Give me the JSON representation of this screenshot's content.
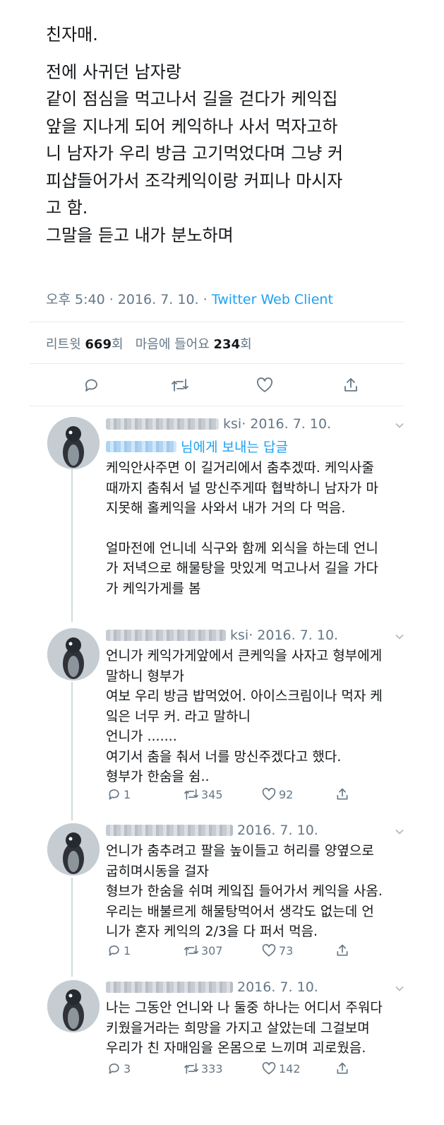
{
  "tweet": {
    "lines": [
      "친자매.",
      "",
      "전에 사귀던 남자랑",
      "같이 점심을 먹고나서 길을 걷다가  케익집",
      "앞을 지나게 되어 케익하나 사서 먹자고하",
      "니 남자가 우리 방금 고기먹었다며 그냥 커",
      "피샵들어가서 조각케익이랑 커피나 마시자",
      "고 함.",
      "그말을 듣고 내가 분노하며"
    ],
    "time": "오후 5:40 · 2016. 7. 10. · ",
    "client": "Twitter Web Client",
    "retweets_label": "리트윗 ",
    "retweets": "669",
    "retweets_unit": "회",
    "likes_label": "마음에 들어요 ",
    "likes": "234",
    "likes_unit": "회"
  },
  "icons": {
    "reply": "reply-icon",
    "retweet": "retweet-icon",
    "like": "heart-icon",
    "share": "share-icon",
    "more": "chevron-down-icon"
  },
  "colors": {
    "link": "#1da1f2",
    "muted": "#657786",
    "text": "#14171a"
  },
  "replies": [
    {
      "name_visible": "",
      "handle_visible": "ksi",
      "date": "· 2016. 7. 10.",
      "reply_to_suffix": "님에게 보내는 답글",
      "lines": [
        "케익안사주면 이 길거리에서 춤추겠따. 케익사줄",
        "때까지 춤춰서 널 망신주게따 협박하니 남자가 마",
        "지못해 홀케익을 사와서 내가 거의 다 먹음.",
        "",
        "얼마전에 언니네 식구와 함께 외식을 하는데 언니",
        "가 저녁으로 해물탕을 맛있게 먹고나서 길을 가다",
        "가 케익가게를 봄"
      ],
      "stats": null
    },
    {
      "name_visible": "",
      "handle_visible": "ksi",
      "date": "· 2016. 7. 10.",
      "reply_to_suffix": "",
      "lines": [
        "언니가 케익가게앞에서 큰케익을 사자고 형부에게",
        "말하니 형부가",
        "여보 우리 방금 밥먹었어. 아이스크림이나 먹자 케",
        "잌은 너무 커. 라고 말하니",
        "언니가 .......",
        "여기서 춤을 춰서 너를 망신주겠다고 했다.",
        "형부가 한숨을 쉼.."
      ],
      "stats": {
        "replies": "1",
        "retweets": "345",
        "likes": "92"
      }
    },
    {
      "name_visible": "",
      "handle_visible": "",
      "date": "2016. 7. 10.",
      "reply_to_suffix": "",
      "lines": [
        "언니가 춤추려고  팔을 높이들고 허리를 양옆으로",
        "굽히며시동을 걸자",
        "형브가 한숨을 쉬며 케잌집 들어가서 케익을 사옴.",
        "우리는 배불르게 해물탕먹어서 생각도 없는데 언",
        "니가 혼자 케익의 2/3을 다 퍼서 먹음."
      ],
      "stats": {
        "replies": "1",
        "retweets": "307",
        "likes": "73"
      }
    },
    {
      "name_visible": "",
      "handle_visible": "",
      "date": "2016. 7. 10.",
      "reply_to_suffix": "",
      "lines": [
        "나는 그동안 언니와 나 둘중 하나는 어디서 주워다",
        "키웠을거라는 희망을 가지고 살았는데  그걸보며",
        "우리가 친 자매임을 온몸으로 느끼며 괴로웠음."
      ],
      "stats": {
        "replies": "3",
        "retweets": "333",
        "likes": "142"
      }
    }
  ]
}
